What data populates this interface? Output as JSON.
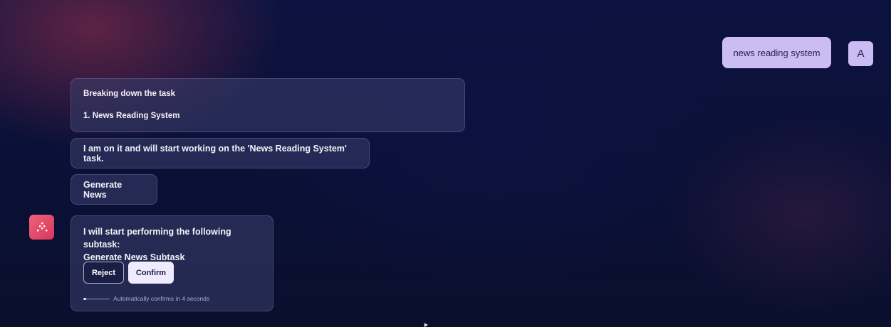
{
  "user_message": {
    "text": "news reading system",
    "avatar_initial": "A"
  },
  "messages": {
    "breakdown": {
      "heading": "Breaking down the task",
      "item": "1. News Reading System"
    },
    "working": {
      "text": "I am on it and will start working on the 'News Reading System' task."
    },
    "generate": {
      "text": "Generate News"
    },
    "subtask": {
      "line1": "I will start performing the following subtask:",
      "line2": "Generate News Subtask",
      "reject_label": "Reject",
      "confirm_label": "Confirm",
      "auto_confirm_text": "Automatically confirms in 4 seconds",
      "auto_confirm_progress": 0.1
    }
  },
  "agent_avatar": {
    "icon": "agent-logo-icon",
    "color": "#e84a6c"
  },
  "colors": {
    "user_bubble": "#cbbcf3",
    "confirm_button": "#eeebff",
    "background": "#0a1035"
  }
}
